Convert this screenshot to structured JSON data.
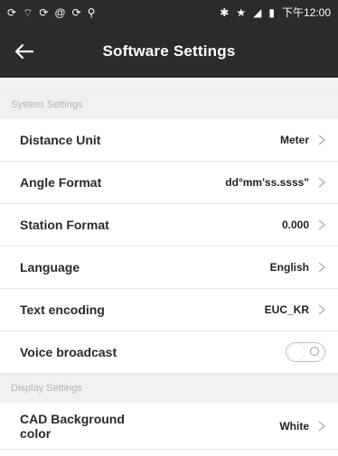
{
  "status_bar": {
    "left_icons": [
      "sync-icon",
      "wifi-icon",
      "sync-icon",
      "at-icon",
      "sync-icon",
      "location-icon"
    ],
    "right_icons": [
      "bluetooth-icon",
      "star-icon",
      "signal-icon",
      "battery-icon"
    ],
    "time": "下午12:00"
  },
  "app_bar": {
    "title": "Software Settings",
    "back_icon": "arrow-left-icon"
  },
  "sections": {
    "system_settings": "System Settings",
    "display_settings": "Display Settings"
  },
  "rows": {
    "distance_unit": {
      "label": "Distance Unit",
      "value": "Meter"
    },
    "angle_format": {
      "label": "Angle Format",
      "value": "dd°mm'ss.ssss\""
    },
    "station_format": {
      "label": "Station Format",
      "value": "0.000"
    },
    "language": {
      "label": "Language",
      "value": "English"
    },
    "text_encoding": {
      "label": "Text encoding",
      "value": "EUC_KR"
    },
    "voice_broadcast": {
      "label": "Voice broadcast",
      "enabled": false
    },
    "cad_background": {
      "label_line1": "CAD Background",
      "label_line2": "color",
      "value": "White"
    }
  },
  "colors": {
    "bar_bg": "#2b2b2b",
    "section_bg": "#f0f0f0",
    "section_text": "#b3b3b3"
  }
}
